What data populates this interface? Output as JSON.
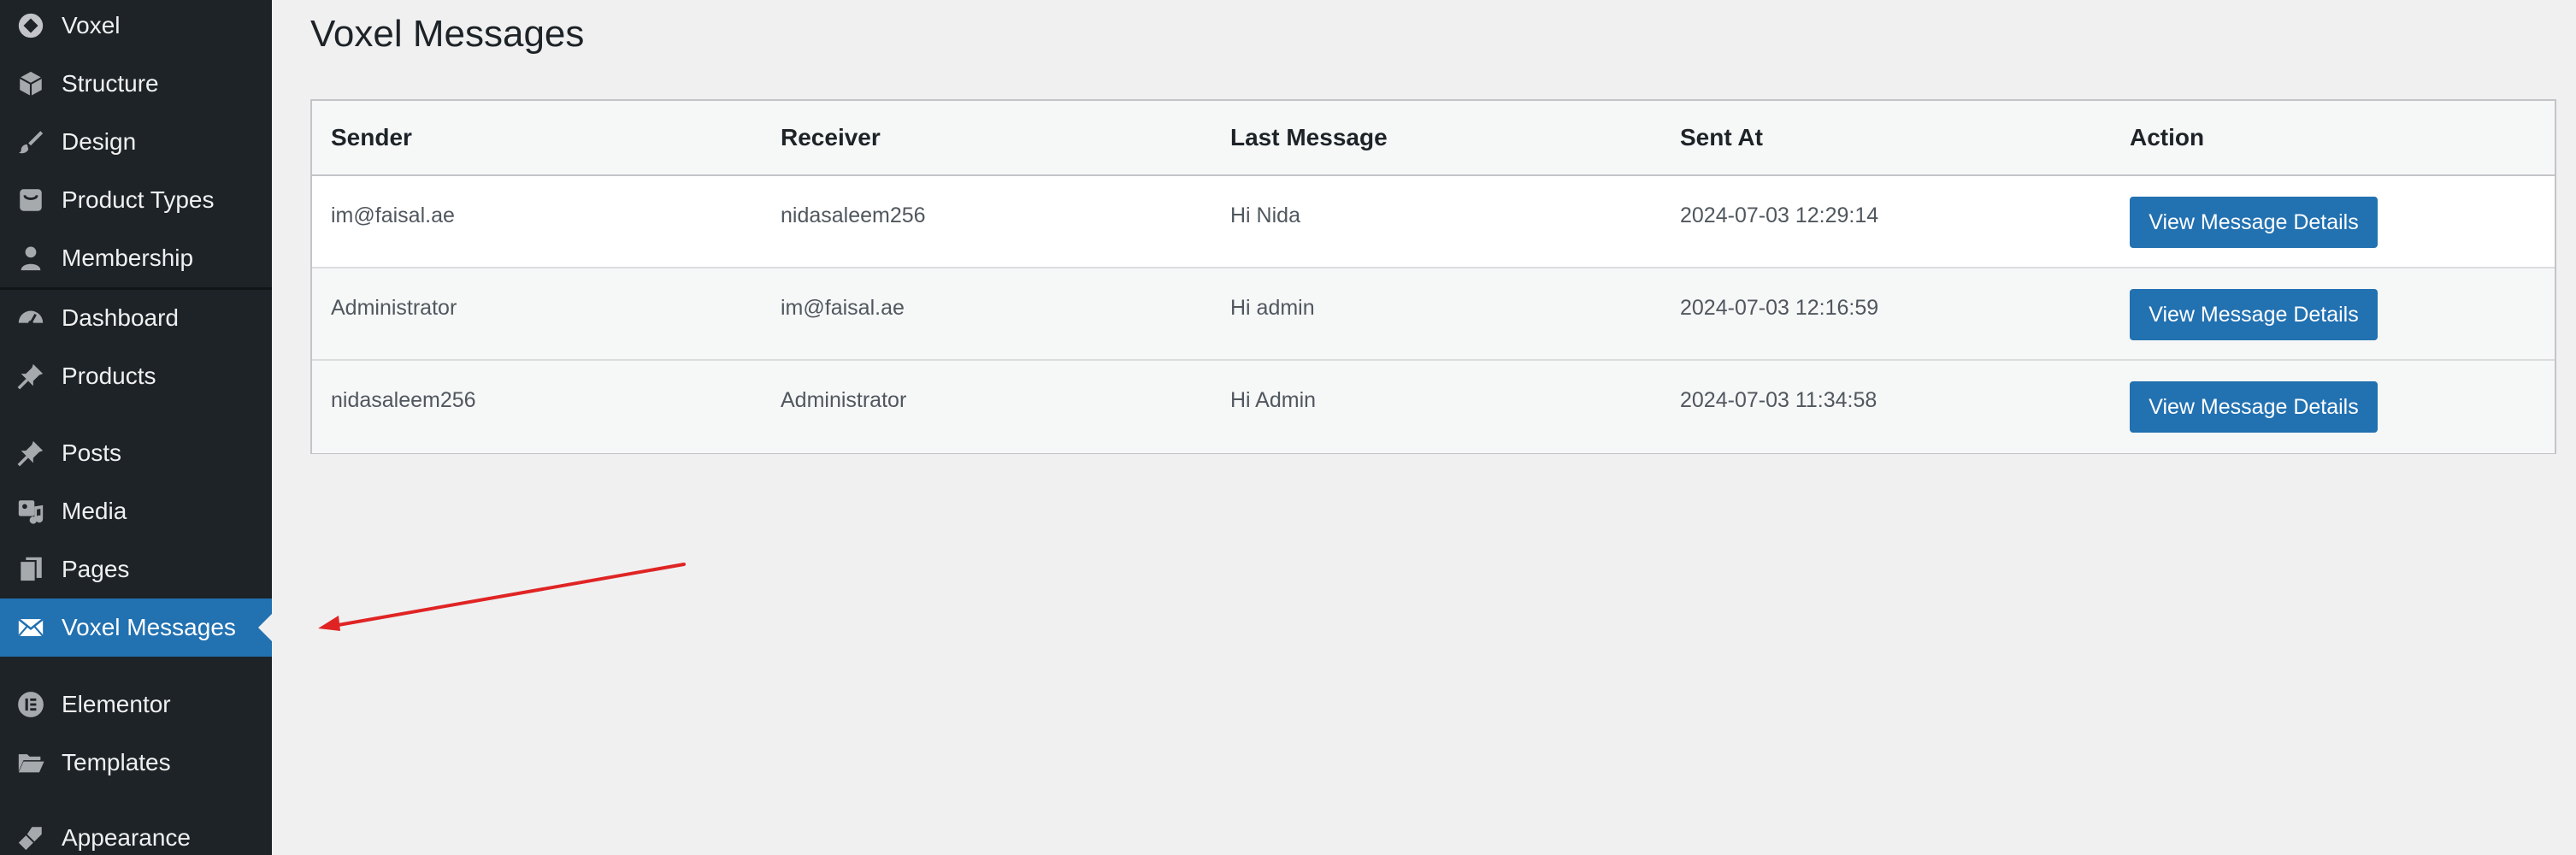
{
  "sidebar": {
    "items": [
      {
        "label": "Voxel",
        "icon": "voxel-logo-icon"
      },
      {
        "label": "Structure",
        "icon": "cube-icon"
      },
      {
        "label": "Design",
        "icon": "brush-icon"
      },
      {
        "label": "Product Types",
        "icon": "bag-icon"
      },
      {
        "label": "Membership",
        "icon": "user-icon"
      },
      {
        "label": "Dashboard",
        "icon": "dashboard-gauge-icon"
      },
      {
        "label": "Products",
        "icon": "pin-icon"
      },
      {
        "label": "Posts",
        "icon": "pin-icon"
      },
      {
        "label": "Media",
        "icon": "media-icon"
      },
      {
        "label": "Pages",
        "icon": "pages-icon"
      },
      {
        "label": "Voxel Messages",
        "icon": "envelope-icon",
        "active": true
      },
      {
        "label": "Elementor",
        "icon": "elementor-icon"
      },
      {
        "label": "Templates",
        "icon": "folder-icon"
      },
      {
        "label": "Appearance",
        "icon": "paintbrush-icon"
      }
    ]
  },
  "main": {
    "title": "Voxel Messages",
    "table": {
      "headers": [
        "Sender",
        "Receiver",
        "Last Message",
        "Sent At",
        "Action"
      ],
      "rows": [
        {
          "sender": "im@faisal.ae",
          "receiver": "nidasaleem256",
          "last_message": "Hi Nida",
          "sent_at": "2024-07-03 12:29:14",
          "action": "View Message Details"
        },
        {
          "sender": "Administrator",
          "receiver": "im@faisal.ae",
          "last_message": "Hi admin",
          "sent_at": "2024-07-03 12:16:59",
          "action": "View Message Details"
        },
        {
          "sender": "nidasaleem256",
          "receiver": "Administrator",
          "last_message": "Hi Admin",
          "sent_at": "2024-07-03 11:34:58",
          "action": "View Message Details"
        }
      ]
    }
  },
  "colors": {
    "sidebar_bg": "#1d2327",
    "accent": "#2271b1",
    "page_bg": "#f0f0f1",
    "annotation_arrow": "#e02424"
  }
}
